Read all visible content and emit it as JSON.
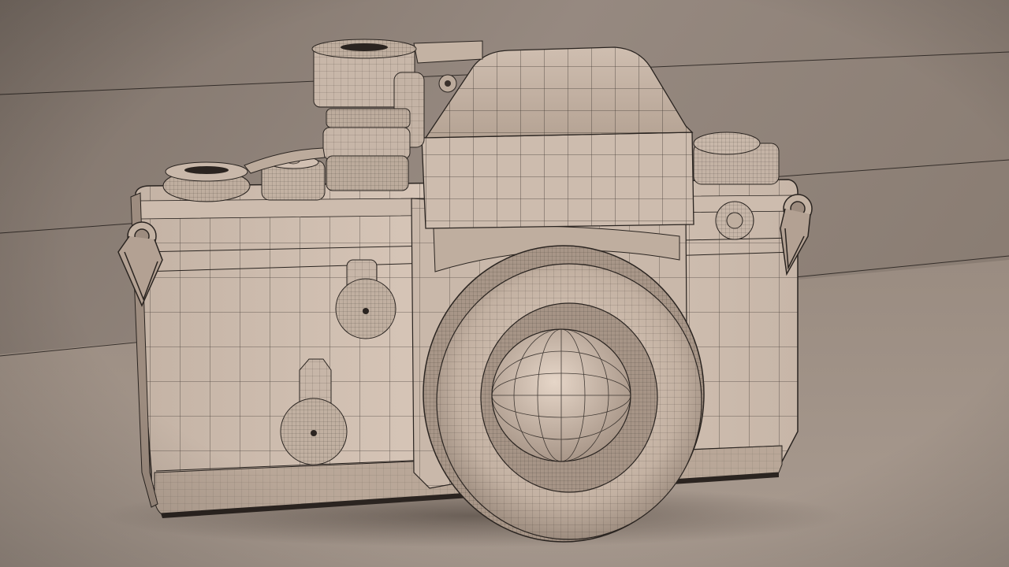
{
  "scene": {
    "subject": "wireframe-camera-render",
    "colors": {
      "backdrop_top": "#8e8177",
      "backdrop_mid": "#9b8d82",
      "floor": "#a4968b",
      "floor_far": "#877a70",
      "body_light": "#d8c7b9",
      "body_mid": "#bba99a",
      "body_dark": "#8d7d71",
      "lens_inner": "#c9b7a8",
      "wire": "#2a2420",
      "shadow": "#3a312b"
    }
  }
}
